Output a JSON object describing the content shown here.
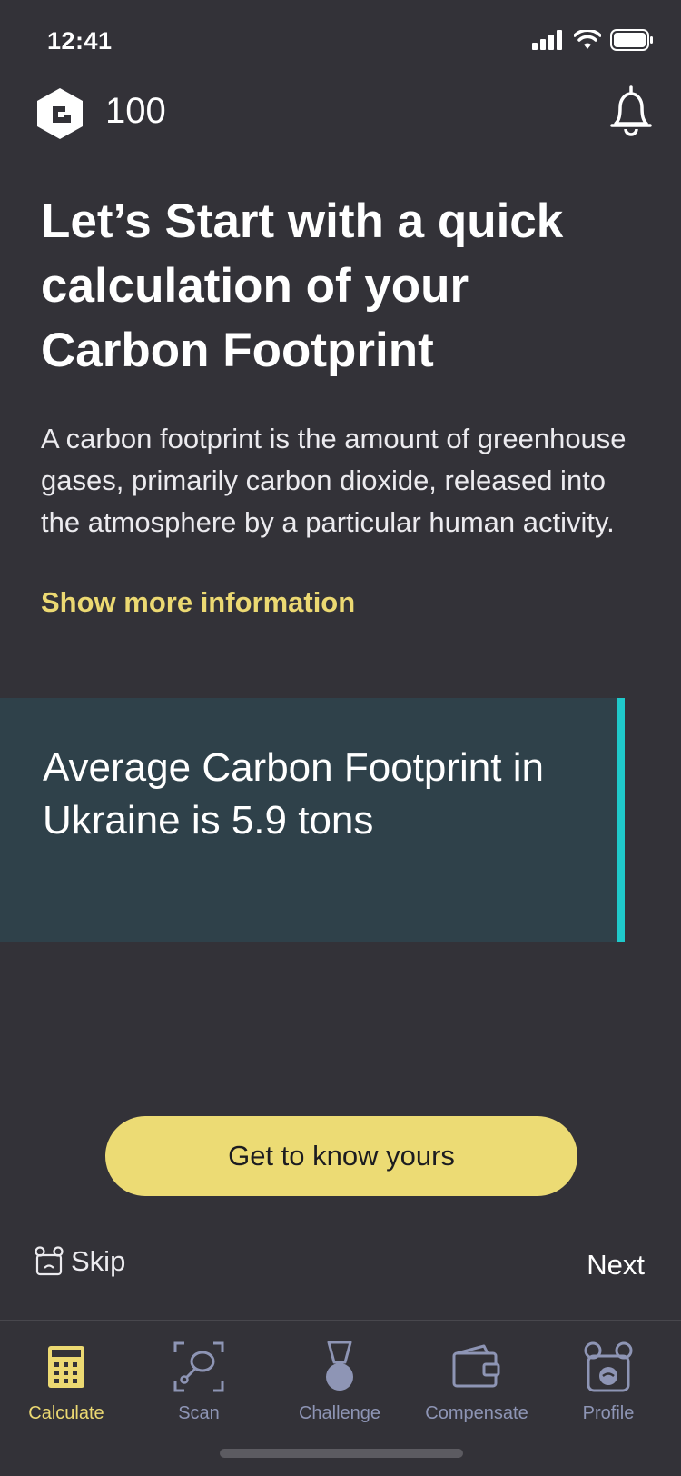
{
  "status_bar": {
    "time": "12:41"
  },
  "header": {
    "points": "100"
  },
  "intro": {
    "title": "Let’s Start with a quick calculation of your Carbon Footprint",
    "description": "A carbon footprint is the amount of greenhouse gases, primarily carbon dioxide, released into the atmosphere by a particular human activity.",
    "more_link": "Show more information"
  },
  "stat_card": {
    "text": "Average Carbon Footprint in Ukraine is 5.9 tons"
  },
  "cta": {
    "label": "Get to know yours"
  },
  "footer_nav": {
    "skip_label": "Skip",
    "next_label": "Next"
  },
  "tabs": [
    {
      "label": "Calculate",
      "icon": "calculator-icon",
      "active": true
    },
    {
      "label": "Scan",
      "icon": "scan-icon",
      "active": false
    },
    {
      "label": "Challenge",
      "icon": "medal-icon",
      "active": false
    },
    {
      "label": "Compensate",
      "icon": "wallet-icon",
      "active": false
    },
    {
      "label": "Profile",
      "icon": "profile-icon",
      "active": false
    }
  ],
  "colors": {
    "background": "#333238",
    "accent": "#ecd972",
    "card": "#2f414a",
    "card_border": "#1fc9cb",
    "tab_inactive": "#8e95b5"
  }
}
